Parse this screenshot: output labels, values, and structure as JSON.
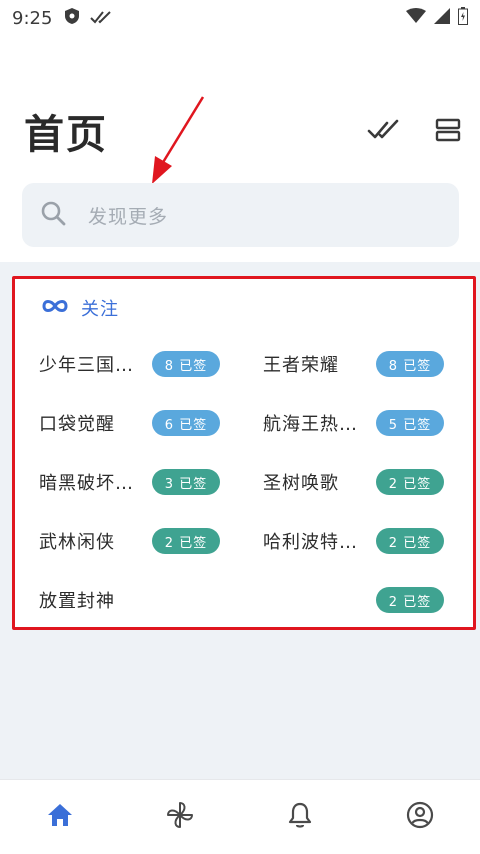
{
  "status_bar": {
    "time": "9:25"
  },
  "header": {
    "title": "首页"
  },
  "search": {
    "placeholder": "发现更多"
  },
  "follow": {
    "title": "关注",
    "games": [
      {
        "name": "少年三国…",
        "badge": "8 已签",
        "badge_color": "#5aa8dd"
      },
      {
        "name": "王者荣耀",
        "badge": "8 已签",
        "badge_color": "#5aa8dd"
      },
      {
        "name": "口袋觉醒",
        "badge": "6 已签",
        "badge_color": "#5aa8dd"
      },
      {
        "name": "航海王热…",
        "badge": "5 已签",
        "badge_color": "#5aa8dd"
      },
      {
        "name": "暗黑破坏…",
        "badge": "3 已签",
        "badge_color": "#3fa391"
      },
      {
        "name": "圣树唤歌",
        "badge": "2 已签",
        "badge_color": "#3fa391"
      },
      {
        "name": "武林闲侠",
        "badge": "2 已签",
        "badge_color": "#3fa391"
      },
      {
        "name": "哈利波特…",
        "badge": "2 已签",
        "badge_color": "#3fa391"
      },
      {
        "name": "放置封神",
        "badge": "2 已签",
        "badge_color": "#3fa391"
      }
    ]
  },
  "bottom_nav": {
    "items": [
      {
        "icon": "home-icon",
        "active": true
      },
      {
        "icon": "pinwheel-icon",
        "active": false
      },
      {
        "icon": "bell-icon",
        "active": false
      },
      {
        "icon": "profile-icon",
        "active": false
      }
    ]
  },
  "colors": {
    "accent": "#3b6fd8",
    "badge_blue": "#5aa8dd",
    "badge_teal": "#3fa391",
    "highlight_border": "#e0161f",
    "background": "#eef2f6"
  }
}
